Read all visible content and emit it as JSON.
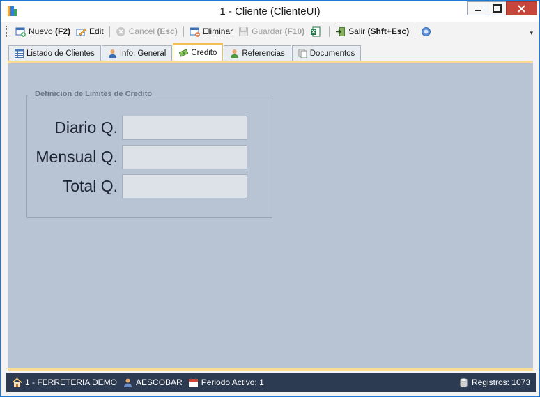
{
  "window": {
    "title": "1 - Cliente (ClienteUI)",
    "app_icon_colors": [
      "#f5a623",
      "#2b7de9",
      "#3aa657"
    ]
  },
  "toolbar": {
    "nuevo": "Nuevo",
    "nuevo_key": "(F2)",
    "edit": "Edit",
    "cancel": "Cancel",
    "cancel_key": "(Esc)",
    "eliminar": "Eliminar",
    "guardar": "Guardar",
    "guardar_key": "(F10)",
    "salir": "Salir",
    "salir_key": "(Shft+Esc)",
    "overflow": "▾"
  },
  "tabs": [
    {
      "label": "Listado de Clientes",
      "icon": "table-icon",
      "active": false
    },
    {
      "label": "Info. General",
      "icon": "user-icon",
      "active": false
    },
    {
      "label": "Credito",
      "icon": "money-icon",
      "active": true
    },
    {
      "label": "Referencias",
      "icon": "user-green-icon",
      "active": false
    },
    {
      "label": "Documentos",
      "icon": "documents-icon",
      "active": false
    }
  ],
  "credit_limits": {
    "legend": "Definicion de Limites de Credito",
    "fields": [
      {
        "label": "Diario Q.",
        "value": ""
      },
      {
        "label": "Mensual Q.",
        "value": ""
      },
      {
        "label": "Total Q.",
        "value": ""
      }
    ]
  },
  "statusbar": {
    "company": "1 - FERRETERIA DEMO",
    "user": "AESCOBAR",
    "period": "Periodo Activo: 1",
    "records": "Registros: 1073"
  },
  "colors": {
    "content_bg": "#b8c4d3",
    "statusbar_bg": "#2c3b52",
    "accent_tab": "#f2c055",
    "close_button": "#c7463b"
  }
}
